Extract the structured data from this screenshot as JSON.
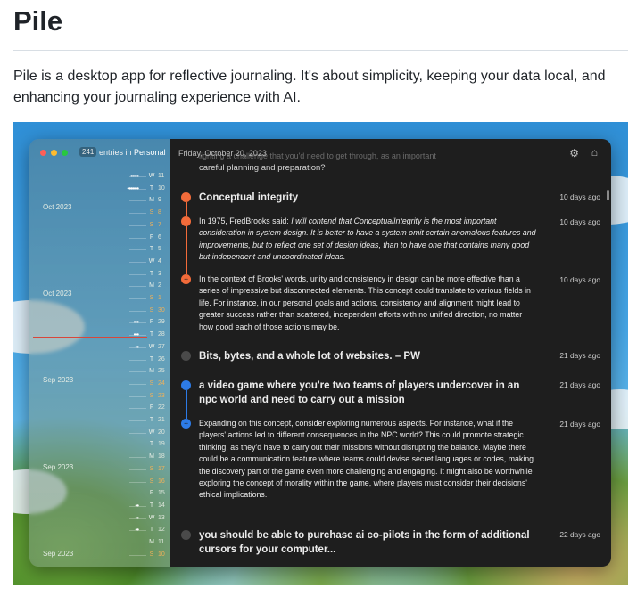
{
  "readme": {
    "title": "Pile",
    "intro": "Pile is a desktop app for reflective journaling. It's about simplicity, keeping your data local, and enhancing your journaling experience with AI."
  },
  "app": {
    "entry_count": "241",
    "entries_in": "entries in",
    "journal_name": "Personal",
    "date_header": "Friday, October 20, 2023",
    "carryover_text": "careful planning and preparation?",
    "months": [
      "Oct 2023",
      "Oct 2023",
      "Sep 2023",
      "Sep 2023",
      "Sep 2023"
    ],
    "calendar": [
      {
        "day": "W",
        "num": "11",
        "dots": "•••••"
      },
      {
        "day": "T",
        "num": "10",
        "dots": "•••••••"
      },
      {
        "day": "M",
        "num": "9",
        "dots": ""
      },
      {
        "day": "S",
        "num": "8",
        "dots": ""
      },
      {
        "day": "S",
        "num": "7",
        "dots": ""
      },
      {
        "day": "F",
        "num": "6",
        "dots": ""
      },
      {
        "day": "T",
        "num": "5",
        "dots": ""
      },
      {
        "day": "W",
        "num": "4",
        "dots": ""
      },
      {
        "day": "T",
        "num": "3",
        "dots": ""
      },
      {
        "day": "M",
        "num": "2",
        "dots": ""
      },
      {
        "day": "S",
        "num": "1",
        "dots": ""
      },
      {
        "day": "S",
        "num": "30",
        "dots": ""
      },
      {
        "day": "F",
        "num": "29",
        "dots": "•••"
      },
      {
        "day": "T",
        "num": "28",
        "dots": "•••"
      },
      {
        "day": "W",
        "num": "27",
        "dots": "••"
      },
      {
        "day": "T",
        "num": "26",
        "dots": ""
      },
      {
        "day": "M",
        "num": "25",
        "dots": ""
      },
      {
        "day": "S",
        "num": "24",
        "dots": ""
      },
      {
        "day": "S",
        "num": "23",
        "dots": ""
      },
      {
        "day": "F",
        "num": "22",
        "dots": ""
      },
      {
        "day": "T",
        "num": "21",
        "dots": ""
      },
      {
        "day": "W",
        "num": "20",
        "dots": ""
      },
      {
        "day": "T",
        "num": "19",
        "dots": ""
      },
      {
        "day": "M",
        "num": "18",
        "dots": ""
      },
      {
        "day": "S",
        "num": "17",
        "dots": ""
      },
      {
        "day": "S",
        "num": "16",
        "dots": ""
      },
      {
        "day": "F",
        "num": "15",
        "dots": ""
      },
      {
        "day": "T",
        "num": "14",
        "dots": "••"
      },
      {
        "day": "W",
        "num": "13",
        "dots": "••"
      },
      {
        "day": "T",
        "num": "12",
        "dots": "••"
      },
      {
        "day": "M",
        "num": "11",
        "dots": ""
      },
      {
        "day": "S",
        "num": "10",
        "dots": ""
      }
    ],
    "entries": [
      {
        "kind": "title",
        "color": "#f26b3a",
        "text": "Conceptual integrity",
        "ago": "10 days ago"
      },
      {
        "kind": "quote",
        "color": "#f26b3a",
        "prefix": "In 1975, FredBrooks said: ",
        "italic": "I will contend that ConceptualIntegrity is the most important consideration in system design. It is better to have a system omit certain anomalous features and improvements, but to reflect one set of design ideas, than to have one that contains many good but independent and uncoordinated ideas.",
        "ago": "10 days ago"
      },
      {
        "kind": "ai",
        "color": "#f26b3a",
        "text": "In the context of Brooks' words, unity and consistency in design can be more effective than a series of impressive but disconnected elements. This concept could translate to various fields in life. For instance, in our personal goals and actions, consistency and alignment might lead to greater success rather than scattered, independent efforts with no unified direction, no matter how good each of those actions may be.",
        "ago": "10 days ago"
      },
      {
        "kind": "title",
        "color": "#4a4a4a",
        "text": "Bits, bytes, and a whole lot of websites. – PW",
        "ago": "21 days ago"
      },
      {
        "kind": "title",
        "color": "#2d7be6",
        "text": "a video game where you're two teams of players undercover in an npc world and need to carry out a mission",
        "ago": "21 days ago"
      },
      {
        "kind": "ai",
        "color": "#2d7be6",
        "text": "Expanding on this concept, consider exploring numerous aspects. For instance, what if the players' actions led to different consequences in the NPC world? This could promote strategic thinking, as they'd have to carry out their missions without disrupting the balance. Maybe there could be a communication feature where teams could devise secret languages or codes, making the discovery part of the game even more challenging and engaging. It might also be worthwhile exploring the concept of morality within the game, where players must consider their decisions' ethical implications.",
        "ago": "21 days ago"
      },
      {
        "kind": "title",
        "color": "#4a4a4a",
        "text": "you should be able to purchase ai co-pilots in the form of additional cursors for your computer...",
        "ago": "22 days ago"
      }
    ]
  },
  "colors": {
    "close": "#ff5f57",
    "minimize": "#febc2e",
    "zoom": "#28c840",
    "weekend": "#f0b15a",
    "today_marker": "#d8473a"
  },
  "icons": {
    "settings": "gear-icon",
    "home": "home-icon"
  }
}
